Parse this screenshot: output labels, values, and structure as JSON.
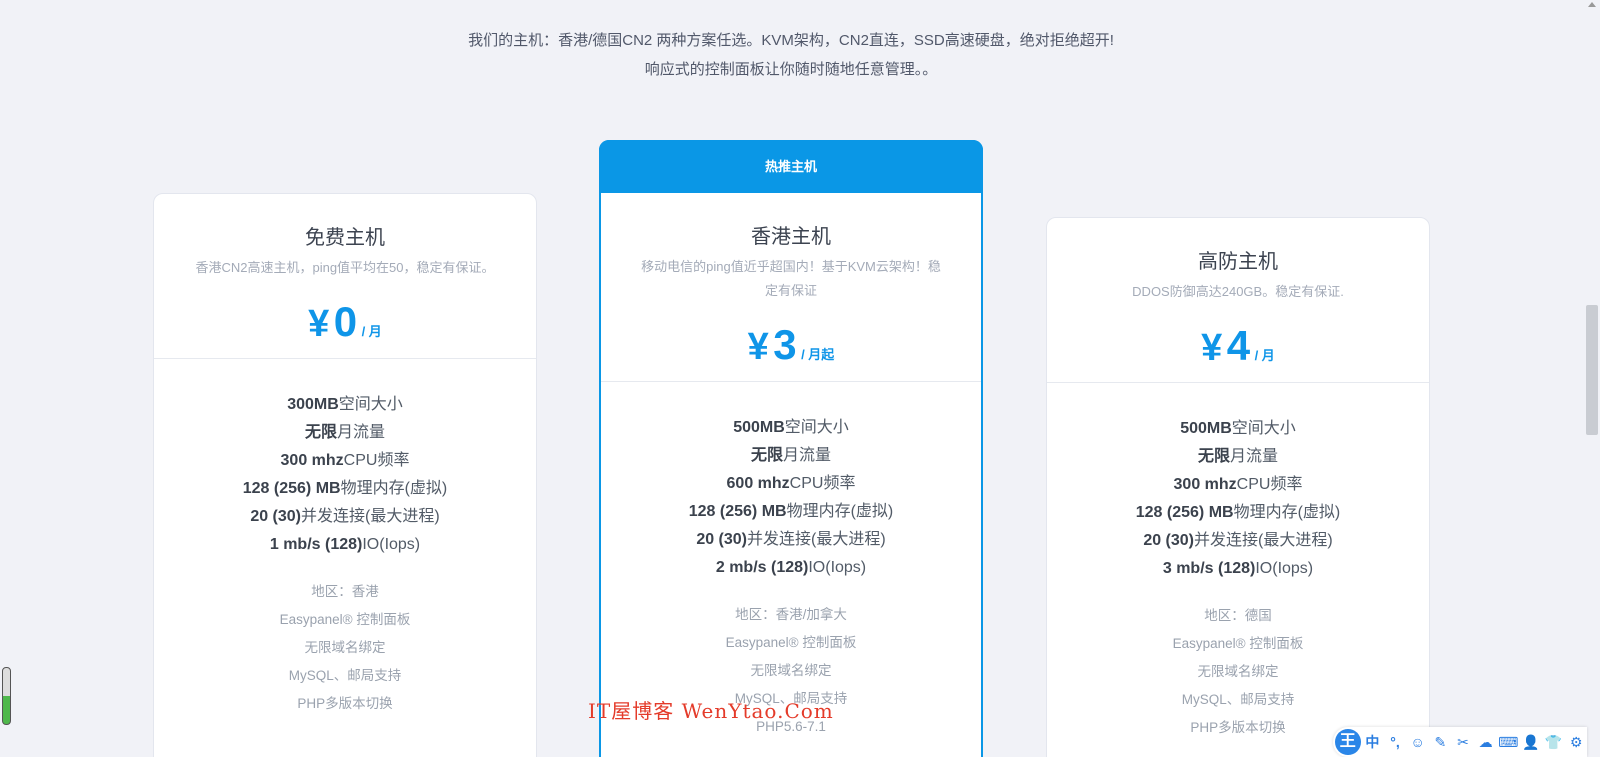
{
  "intro": {
    "line1": "我们的主机：香港/德国CN2 两种方案任选。KVM架构，CN2直连，SSD高速硬盘，绝对拒绝超开!",
    "line2": "响应式的控制面板让你随时随地任意管理。。"
  },
  "plans": [
    {
      "title": "免费主机",
      "desc": "香港CN2高速主机，ping值平均在50，稳定有保证。",
      "currency": "¥",
      "price": "0",
      "unit": "/ 月",
      "specs": [
        {
          "b": "300MB",
          "t": "空间大小"
        },
        {
          "b": "无限",
          "t": "月流量"
        },
        {
          "b": "300 mhz",
          "t": "CPU频率"
        },
        {
          "b": "128 (256) MB",
          "t": "物理内存(虚拟)"
        },
        {
          "b": "20 (30)",
          "t": "并发连接(最大进程)"
        },
        {
          "b": "1 mb/s (128)",
          "t": "IO(Iops)"
        }
      ],
      "extras": [
        "地区：香港",
        "Easypanel® 控制面板",
        "无限域名绑定",
        "MySQL、邮局支持",
        "PHP多版本切换"
      ]
    },
    {
      "badge": "热推主机",
      "title": "香港主机",
      "desc": "移动电信的ping值近乎超国内！基于KVM云架构！稳定有保证",
      "currency": "¥",
      "price": "3",
      "unit": "/ 月起",
      "specs": [
        {
          "b": "500MB",
          "t": "空间大小"
        },
        {
          "b": "无限",
          "t": "月流量"
        },
        {
          "b": "600 mhz",
          "t": "CPU频率"
        },
        {
          "b": "128 (256) MB",
          "t": "物理内存(虚拟)"
        },
        {
          "b": "20 (30)",
          "t": "并发连接(最大进程)"
        },
        {
          "b": "2 mb/s (128)",
          "t": "IO(Iops)"
        }
      ],
      "extras": [
        "地区：香港/加拿大",
        "Easypanel® 控制面板",
        "无限域名绑定",
        "MySQL、邮局支持",
        "PHP5.6-7.1"
      ]
    },
    {
      "title": "高防主机",
      "desc": "DDOS防御高达240GB。稳定有保证.",
      "currency": "¥",
      "price": "4",
      "unit": "/ 月",
      "specs": [
        {
          "b": "500MB",
          "t": "空间大小"
        },
        {
          "b": "无限",
          "t": "月流量"
        },
        {
          "b": "300 mhz",
          "t": "CPU频率"
        },
        {
          "b": "128 (256) MB",
          "t": "物理内存(虚拟)"
        },
        {
          "b": "20 (30)",
          "t": "并发连接(最大进程)"
        },
        {
          "b": "3 mb/s (128)",
          "t": "IO(Iops)"
        }
      ],
      "extras": [
        "地区：德国",
        "Easypanel® 控制面板",
        "无限域名绑定",
        "MySQL、邮局支持",
        "PHP多版本切换"
      ]
    }
  ],
  "watermark": "IT屋博客 WenYtao.Com",
  "ime": {
    "logo": "王",
    "buttons": [
      "中",
      "°,",
      "☺",
      "✎",
      "✂",
      "☁",
      "⌨",
      "👤",
      "👕",
      "⚙"
    ]
  },
  "colors": {
    "accent": "#0a97e6",
    "background": "#f1f2f7"
  }
}
